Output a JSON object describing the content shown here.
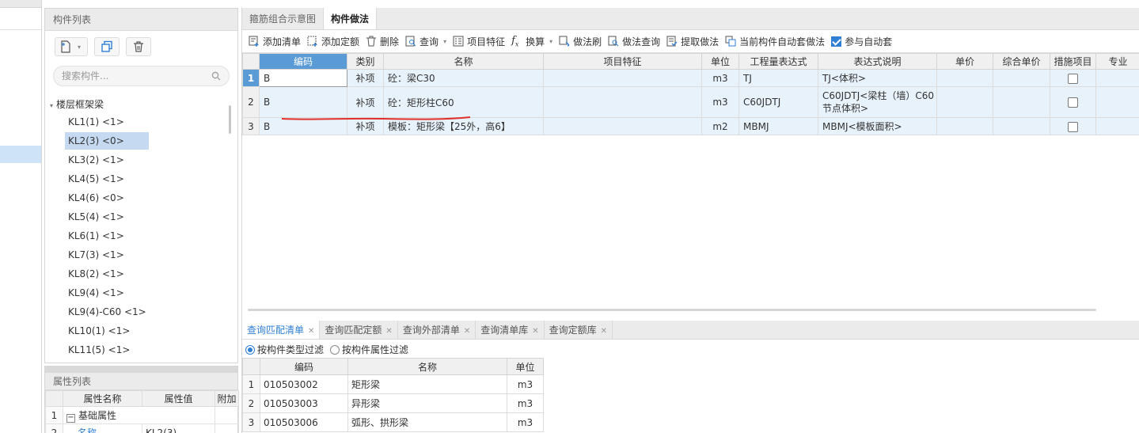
{
  "component_list": {
    "title": "构件列表",
    "search_placeholder": "搜索构件...",
    "tree_root": "楼层框架梁",
    "items": [
      "KL1(1) <1>",
      "KL2(3) <0>",
      "KL3(2) <1>",
      "KL4(5) <1>",
      "KL4(6) <0>",
      "KL5(4) <1>",
      "KL6(1) <1>",
      "KL7(3) <1>",
      "KL8(2) <1>",
      "KL9(4) <1>",
      "KL9(4)-C60 <1>",
      "KL10(1) <1>",
      "KL11(5) <1>"
    ],
    "selected_index": 1
  },
  "property_list": {
    "title": "属性列表",
    "headers": [
      "属性名称",
      "属性值",
      "附加"
    ],
    "rows": [
      {
        "num": "1",
        "name": "基础属性",
        "value": ""
      },
      {
        "num": "2",
        "name": "名称",
        "value": "KL2(3)"
      }
    ]
  },
  "main_tabs": [
    "箍筋组合示意图",
    "构件做法"
  ],
  "active_tab": 1,
  "toolbar": {
    "add_list": "添加清单",
    "add_quota": "添加定额",
    "delete": "删除",
    "query": "查询",
    "item_feature": "项目特征",
    "calc": "换算",
    "method_brush": "做法刷",
    "method_query": "做法查询",
    "extract_method": "提取做法",
    "auto_apply_current": "当前构件自动套做法",
    "join_auto": "参与自动套"
  },
  "grid": {
    "headers": [
      "编码",
      "类别",
      "名称",
      "项目特征",
      "单位",
      "工程量表达式",
      "表达式说明",
      "单价",
      "综合单价",
      "措施项目",
      "专业"
    ],
    "rows": [
      {
        "num": "1",
        "code": "B",
        "type": "补项",
        "name": "砼：梁C30",
        "feature": "",
        "unit": "m3",
        "expr": "TJ",
        "desc": "TJ<体积>"
      },
      {
        "num": "2",
        "code": "B",
        "type": "补项",
        "name": "砼：矩形柱C60",
        "feature": "",
        "unit": "m3",
        "expr": "C60JDTJ",
        "desc": "C60JDTJ<梁柱（墙）C60节点体积>"
      },
      {
        "num": "3",
        "code": "B",
        "type": "补项",
        "name": "模板：矩形梁【25外，高6】",
        "feature": "",
        "unit": "m2",
        "expr": "MBMJ",
        "desc": "MBMJ<模板面积>"
      }
    ]
  },
  "query_tabs": [
    "查询匹配清单",
    "查询匹配定额",
    "查询外部清单",
    "查询清单库",
    "查询定额库"
  ],
  "filters": {
    "by_type": "按构件类型过滤",
    "by_attr": "按构件属性过滤"
  },
  "query_grid": {
    "headers": [
      "编码",
      "名称",
      "单位"
    ],
    "rows": [
      {
        "num": "1",
        "code": "010503002",
        "name": "矩形梁",
        "unit": "m3"
      },
      {
        "num": "2",
        "code": "010503003",
        "name": "异形梁",
        "unit": "m3"
      },
      {
        "num": "3",
        "code": "010503006",
        "name": "弧形、拱形梁",
        "unit": "m3"
      }
    ]
  },
  "colors": {
    "accent": "#2f7fd5",
    "header_highlight": "#5b9bd5",
    "row_bg": "#e8f2fb",
    "annotation": "#e0312c"
  }
}
